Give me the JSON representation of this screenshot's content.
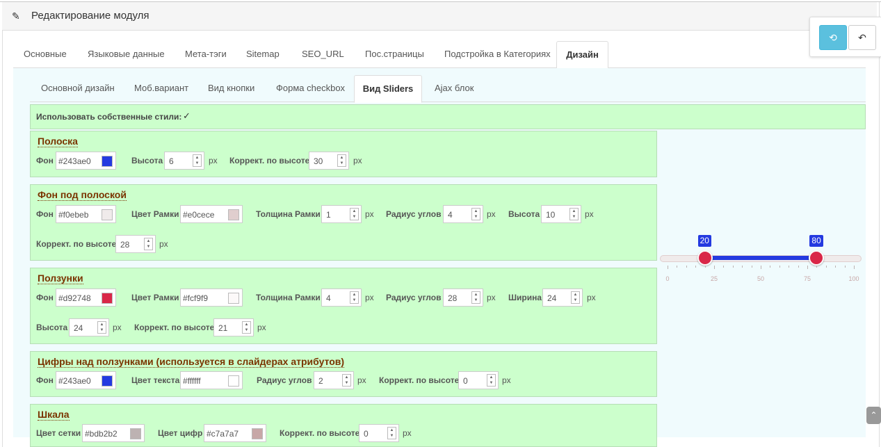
{
  "header": {
    "title": "Редактирование модуля"
  },
  "actions": {
    "refresh_icon": "⟲",
    "back_icon": "↶"
  },
  "tabs_main": [
    {
      "label": "Основные"
    },
    {
      "label": "Языковые данные"
    },
    {
      "label": "Мета-тэги"
    },
    {
      "label": "Sitemap"
    },
    {
      "label": "SEO_URL"
    },
    {
      "label": "Пос.страницы"
    },
    {
      "label": "Подстройка в Категориях"
    },
    {
      "label": "Дизайн",
      "active": true
    }
  ],
  "tabs_design": [
    {
      "label": "Основной дизайн"
    },
    {
      "label": "Моб.вариант"
    },
    {
      "label": "Вид кнопки"
    },
    {
      "label": "Форма checkbox"
    },
    {
      "label": "Вид Sliders",
      "active": true
    },
    {
      "label": "Ajax блок"
    }
  ],
  "own_styles": {
    "label": "Использовать собственные стили:",
    "checked": true
  },
  "sections": {
    "strip": {
      "title": "Полоска",
      "bg_label": "Фон",
      "bg": "#243ae0",
      "height_label": "Высота",
      "height": "6",
      "corr_label": "Коррект. по высоте",
      "corr": "30"
    },
    "strip_bg": {
      "title": "Фон под полоской",
      "bg_label": "Фон",
      "bg": "#f0ebeb",
      "border_color_label": "Цвет Рамки",
      "border_color": "#e0cece",
      "border_w_label": "Толщина Рамки",
      "border_w": "1",
      "radius_label": "Радиус углов",
      "radius": "4",
      "height_label": "Высота",
      "height": "10",
      "corr_label": "Коррект. по высоте",
      "corr": "28"
    },
    "handles": {
      "title": "Ползунки",
      "bg_label": "Фон",
      "bg": "#d92748",
      "border_color_label": "Цвет Рамки",
      "border_color": "#fcf9f9",
      "border_w_label": "Толщина Рамки",
      "border_w": "4",
      "radius_label": "Радиус углов",
      "radius": "28",
      "width_label": "Ширина",
      "width": "24",
      "height_label": "Высота",
      "height": "24",
      "corr_label": "Коррект. по высоте",
      "corr": "21"
    },
    "numbers": {
      "title": "Цифры над ползунками (используется в слайдерах атрибутов)",
      "bg_label": "Фон",
      "bg": "#243ae0",
      "text_color_label": "Цвет текста",
      "text_color": "#ffffff",
      "radius_label": "Радиус углов",
      "radius": "2",
      "corr_label": "Коррект. по высоте",
      "corr": "0"
    },
    "scale": {
      "title": "Шкала",
      "grid_label": "Цвет сетки",
      "grid": "#bdb2b2",
      "digits_label": "Цвет цифр",
      "digits": "#c7a7a7",
      "corr_label": "Коррект. по высоте",
      "corr": "0"
    }
  },
  "unit": "px",
  "preview": {
    "min": 0,
    "max": 100,
    "from": 20,
    "to": 80,
    "ticks": [
      "0",
      "25",
      "50",
      "75",
      "100"
    ]
  }
}
